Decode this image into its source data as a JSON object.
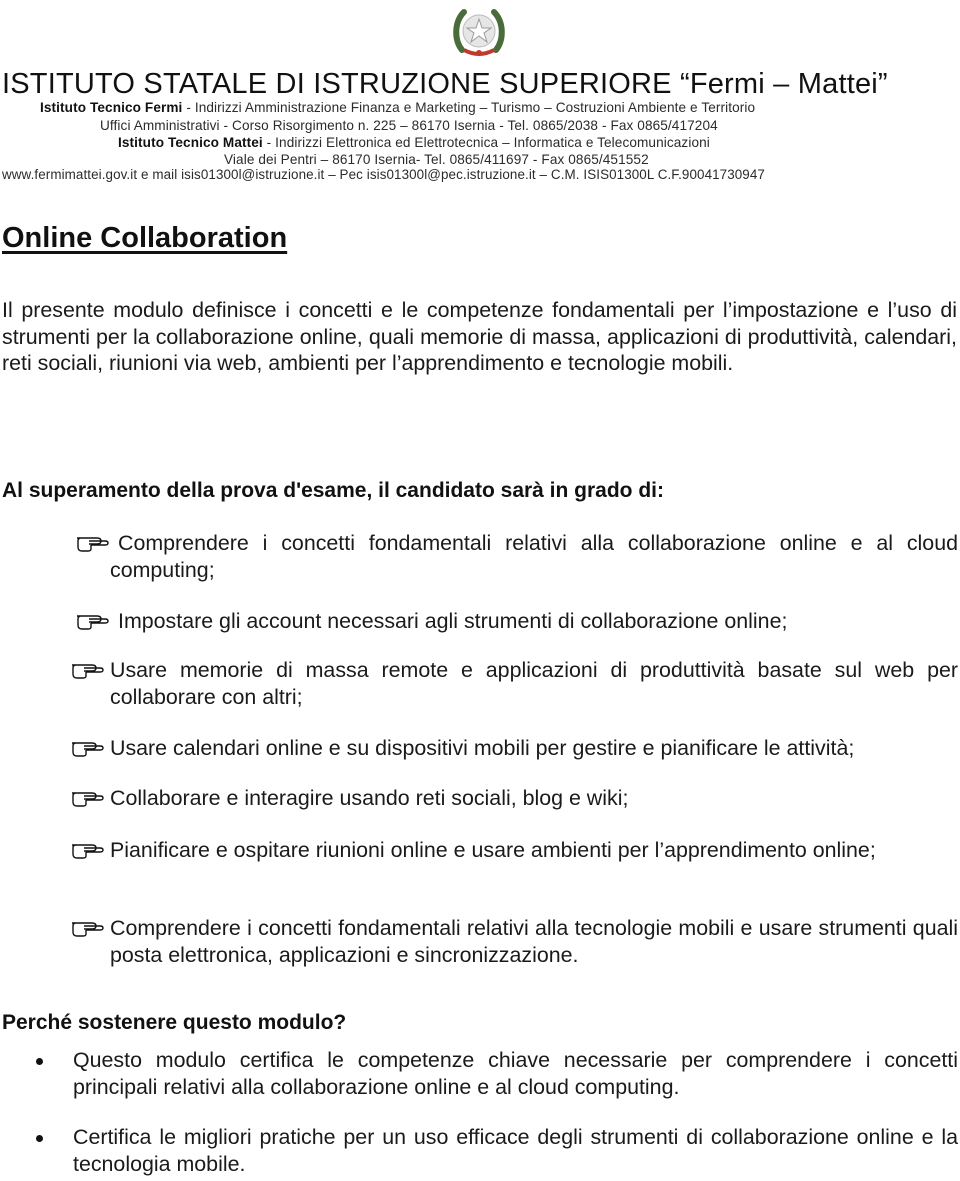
{
  "letterhead": {
    "emblem_icon": "italian-republic-emblem-icon",
    "institution_name": "ISTITUTO STATALE DI ISTRUZIONE SUPERIORE “Fermi – Mattei”",
    "line1_bold": "Istituto Tecnico Fermi",
    "line1_rest": " -  Indirizzi  Amministrazione Finanza e Marketing – Turismo – Costruzioni Ambiente e Territorio",
    "line2": "Uffici Amministrativi - Corso Risorgimento n. 225 – 86170 Isernia - Tel. 0865/2038 - Fax 0865/417204",
    "line3_bold": "Istituto Tecnico Mattei",
    "line3_rest": " -  Indirizzi  Elettronica ed Elettrotecnica – Informatica e Telecomunicazioni",
    "line4": "Viale dei Pentri – 86170 Isernia- Tel. 0865/411697 - Fax 0865/451552",
    "line5": "www.fermimattei.gov.it e mail  isis01300l@istruzione.it – Pec  isis01300l@pec.istruzione.it – C.M.  ISIS01300L  C.F.90041730947"
  },
  "document": {
    "title": "Online Collaboration",
    "intro": "Il presente modulo definisce i concetti e le competenze fondamentali per l’impostazione e l’uso di strumenti per la collaborazione online, quali memorie di massa, applicazioni di produttività, calendari, reti sociali, riunioni via web, ambienti per l’apprendimento e tecnologie mobili.",
    "objectives_heading": "Al superamento della prova d'esame, il candidato sarà in grado di:",
    "objectives": [
      "Comprendere i concetti fondamentali relativi alla collaborazione online e al cloud computing;",
      "Impostare gli account necessari agli strumenti di collaborazione online;",
      "Usare memorie di massa remote e applicazioni di produttività basate sul web per collaborare con altri;",
      "Usare calendari online e su dispositivi mobili per gestire e pianificare le attività;",
      "Collaborare e interagire usando reti sociali, blog e wiki;",
      "Pianificare e ospitare riunioni online e usare ambienti per l’apprendimento online;",
      "Comprendere i concetti fondamentali relativi alla tecnologie mobili e usare strumenti quali posta elettronica, applicazioni e sincronizzazione."
    ],
    "objective_bullet_icon": "pointing-hand-icon",
    "why_heading": "Perché sostenere questo modulo?",
    "why_points": [
      "Questo modulo certifica le competenze chiave necessarie per comprendere i concetti principali relativi alla collaborazione online e al cloud computing.",
      "Certifica le migliori pratiche per un uso efficace degli strumenti di collaborazione online e la tecnologia mobile."
    ]
  },
  "colors": {
    "text": "#1a1a1a",
    "emblem_green": "#4a6b3a",
    "emblem_red": "#c0392b"
  }
}
